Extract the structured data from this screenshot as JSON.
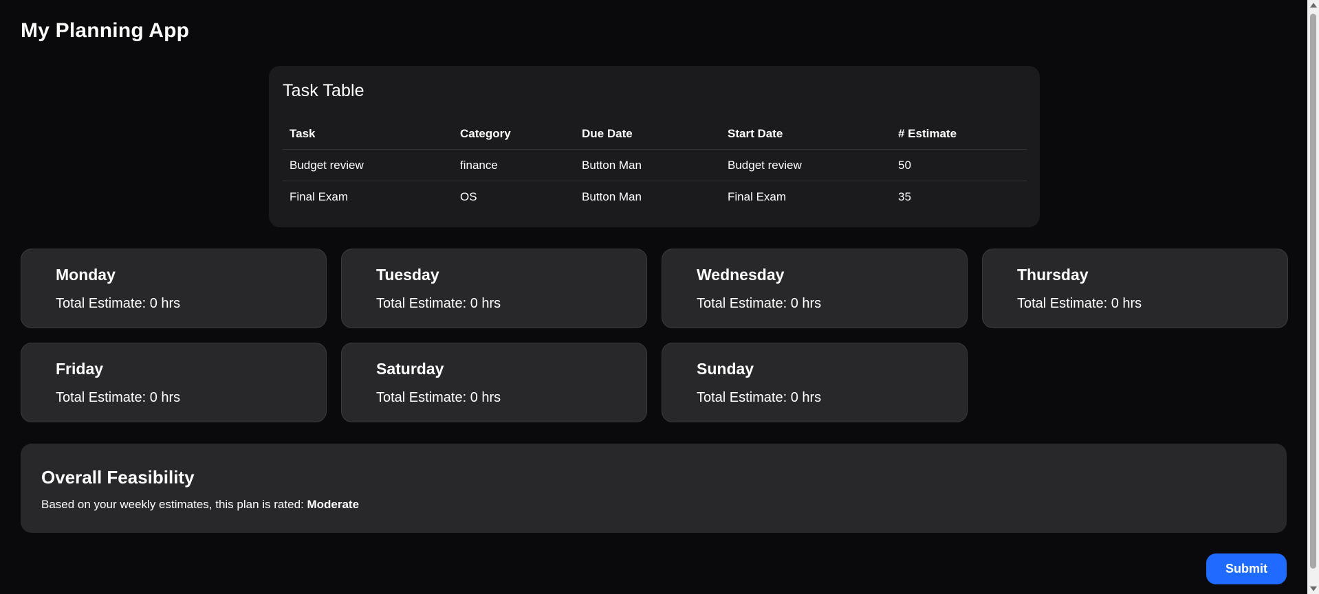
{
  "app": {
    "title": "My Planning App"
  },
  "task_table": {
    "title": "Task Table",
    "headers": [
      "Task",
      "Category",
      "Due Date",
      "Start Date",
      "# Estimate"
    ],
    "rows": [
      [
        "Budget review",
        "finance",
        "Button Man",
        "Budget review",
        "50"
      ],
      [
        "Final Exam",
        "OS",
        "Button Man",
        "Final Exam",
        "35"
      ]
    ]
  },
  "days": [
    {
      "name": "Monday",
      "total": "Total Estimate: 0 hrs"
    },
    {
      "name": "Tuesday",
      "total": "Total Estimate: 0 hrs"
    },
    {
      "name": "Wednesday",
      "total": "Total Estimate: 0 hrs"
    },
    {
      "name": "Thursday",
      "total": "Total Estimate: 0 hrs"
    },
    {
      "name": "Friday",
      "total": "Total Estimate: 0 hrs"
    },
    {
      "name": "Saturday",
      "total": "Total Estimate: 0 hrs"
    },
    {
      "name": "Sunday",
      "total": "Total Estimate: 0 hrs"
    }
  ],
  "feasibility": {
    "title": "Overall Feasibility",
    "text_prefix": "Based on your weekly estimates, this plan is rated: ",
    "rating": "Moderate"
  },
  "submit": {
    "label": "Submit"
  },
  "colors": {
    "background": "#0a0a0c",
    "card": "#28282b",
    "table_card": "#1b1b1e",
    "accent": "#1f6bff"
  }
}
